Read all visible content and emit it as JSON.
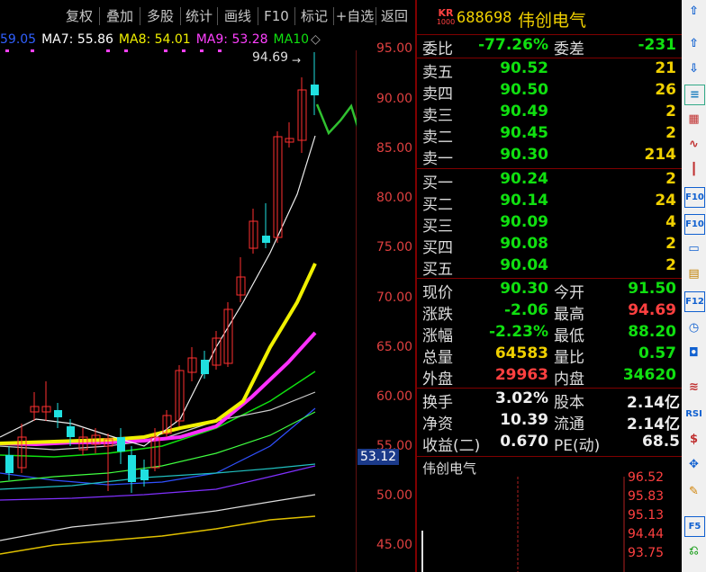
{
  "toolbar": {
    "buttons": [
      "复权",
      "叠加",
      "多股",
      "统计",
      "画线",
      "F10",
      "标记",
      "+自选",
      "返回"
    ]
  },
  "ma_legend": {
    "ma6": "59.05",
    "ma7": "MA7: 55.86",
    "ma8": "MA8: 54.01",
    "ma9": "MA9: 53.28",
    "ma10": "MA10",
    "ma10_marker": "◇"
  },
  "chart": {
    "high_label": "94.69",
    "price_ticks": [
      "95.00",
      "90.00",
      "85.00",
      "80.00",
      "75.00",
      "70.00",
      "65.00",
      "60.00",
      "55.00",
      "50.00",
      "45.00"
    ],
    "current_price": "53.12"
  },
  "header": {
    "badge_top": "KR",
    "badge_bottom": "1000",
    "code": "688698",
    "name": "伟创电气"
  },
  "weibi": {
    "label": "委比",
    "value": "-77.26%",
    "label2": "委差",
    "value2": "-231"
  },
  "asks": [
    {
      "label": "卖五",
      "price": "90.52",
      "vol": "21"
    },
    {
      "label": "卖四",
      "price": "90.50",
      "vol": "26"
    },
    {
      "label": "卖三",
      "price": "90.49",
      "vol": "2"
    },
    {
      "label": "卖二",
      "price": "90.45",
      "vol": "2"
    },
    {
      "label": "卖一",
      "price": "90.30",
      "vol": "214"
    }
  ],
  "bids": [
    {
      "label": "买一",
      "price": "90.24",
      "vol": "2"
    },
    {
      "label": "买二",
      "price": "90.14",
      "vol": "24"
    },
    {
      "label": "买三",
      "price": "90.09",
      "vol": "4"
    },
    {
      "label": "买四",
      "price": "90.08",
      "vol": "2"
    },
    {
      "label": "买五",
      "price": "90.04",
      "vol": "2"
    }
  ],
  "quote": [
    {
      "l1": "现价",
      "v1": "90.30",
      "l2": "今开",
      "v2": "91.50"
    },
    {
      "l1": "涨跌",
      "v1": "-2.06",
      "l2": "最高",
      "v2": "94.69"
    },
    {
      "l1": "涨幅",
      "v1": "-2.23%",
      "l2": "最低",
      "v2": "88.20"
    },
    {
      "l1": "总量",
      "v1": "64583",
      "l2": "量比",
      "v2": "0.57"
    },
    {
      "l1": "外盘",
      "v1": "29963",
      "l2": "内盘",
      "v2": "34620"
    }
  ],
  "fund": [
    {
      "l1": "换手",
      "v1": "3.02%",
      "l2": "股本",
      "v2": "2.14亿"
    },
    {
      "l1": "净资",
      "v1": "10.39",
      "l2": "流通",
      "v2": "2.14亿"
    },
    {
      "l1": "收益(二)",
      "v1": "0.670",
      "l2": "PE(动)",
      "v2": "68.5"
    }
  ],
  "mini": {
    "title": "伟创电气",
    "ticks": [
      "96.52",
      "95.83",
      "95.13",
      "94.44",
      "93.75"
    ]
  },
  "rtool_icons": [
    "up-arrow-icon",
    "down-arrow-icon",
    "report-icon",
    "grid-icon",
    "line-chart-icon",
    "kline-icon",
    "f10-icon",
    "f11-icon",
    "info-icon",
    "f12-icon",
    "clock-icon",
    "box-icon",
    "wave-icon",
    "rsi-icon",
    "dollar-icon",
    "move-icon",
    "pen-icon",
    "f5-icon",
    "back-icon"
  ],
  "rtool_text": {
    "f10": "F10",
    "f12": "F12",
    "rsi": "RSI",
    "f5": "F5"
  }
}
